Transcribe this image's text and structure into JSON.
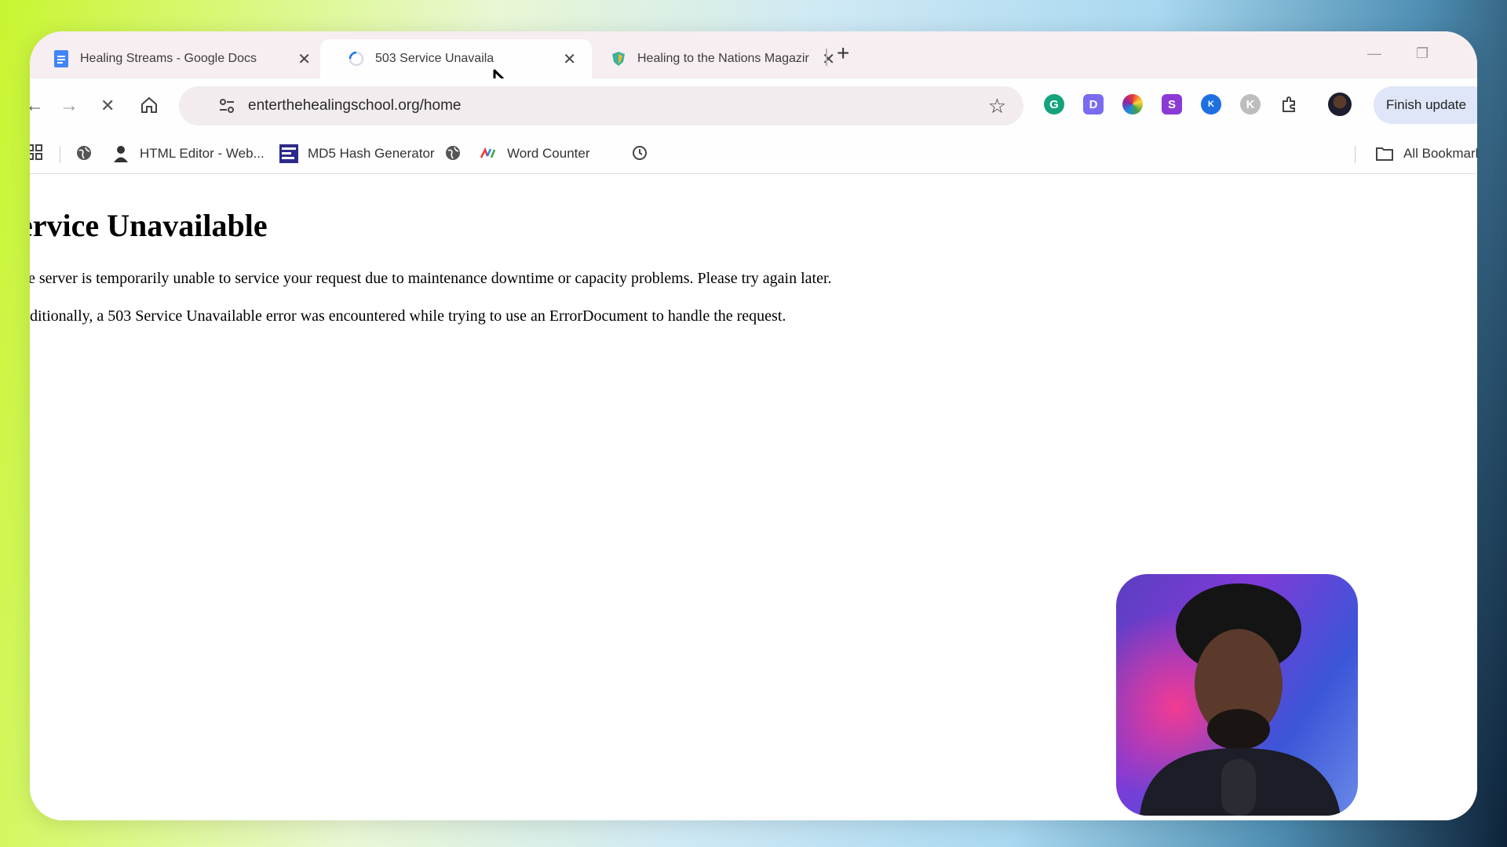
{
  "tabs": [
    {
      "title": "Healing Streams - Google Docs",
      "icon": "google-docs-icon",
      "active": false
    },
    {
      "title": "503 Service Unavaila",
      "icon": "loading-spinner-icon",
      "active": true
    },
    {
      "title": "Healing to the Nations Magazir",
      "icon": "shield-favicon-icon",
      "active": false
    }
  ],
  "toolbar": {
    "url": "enterthehealingschool.org/home",
    "finish_update_label": "Finish update"
  },
  "bookmarks": [
    {
      "label": "HTML Editor - Web...",
      "icon": "html-editor-icon"
    },
    {
      "label": "MD5 Hash Generator",
      "icon": "md5-tool-icon"
    },
    {
      "label": "Word Counter",
      "icon": "word-counter-icon"
    }
  ],
  "all_bookmarks_label": "All Bookmark",
  "page": {
    "heading": "ervice Unavailable",
    "paragraph1": "ne server is temporarily unable to service your request due to maintenance downtime or capacity problems. Please try again later.",
    "paragraph2": "dditionally, a 503 Service Unavailable error was encountered while trying to use an ErrorDocument to handle the request."
  },
  "colors": {
    "accent": "#1a73e8",
    "tabstrip": "#f6eef1",
    "finish_update_bg": "#dfe6f8"
  }
}
